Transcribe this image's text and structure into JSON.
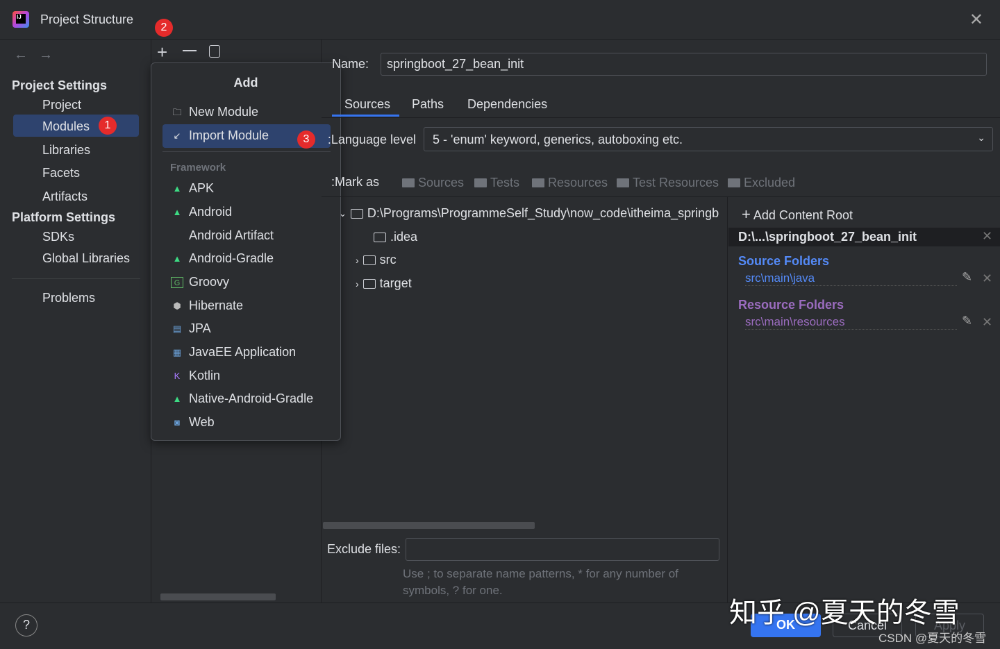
{
  "window": {
    "title": "Project Structure"
  },
  "badges": [
    "1",
    "2",
    "3"
  ],
  "sidebar": {
    "project_settings": "Project Settings",
    "project_items": [
      "Project",
      "Modules",
      "Libraries",
      "Facets",
      "Artifacts"
    ],
    "platform_settings": "Platform Settings",
    "platform_items": [
      "SDKs",
      "Global Libraries"
    ],
    "problems": "Problems"
  },
  "popup": {
    "title": "Add",
    "new_module": "New Module",
    "import_module": "Import Module",
    "framework_header": "Framework",
    "frameworks": [
      "APK",
      "Android",
      "Android Artifact",
      "Android-Gradle",
      "Groovy",
      "Hibernate",
      "JPA",
      "JavaEE Application",
      "Kotlin",
      "Native-Android-Gradle",
      "Web"
    ]
  },
  "module": {
    "name_label": "Name:",
    "name_value": "springboot_27_bean_init",
    "tabs": [
      "Sources",
      "Paths",
      "Dependencies"
    ],
    "language_label": "Language level:",
    "language_value": "5 - 'enum' keyword, generics, autoboxing etc.",
    "mark_as_label": "Mark as:",
    "mark_as": [
      "Sources",
      "Tests",
      "Resources",
      "Test Resources",
      "Excluded"
    ],
    "tree": {
      "root": "D:\\Programs\\ProgrammeSelf_Study\\now_code\\itheima_springb",
      "children": [
        ".idea",
        "src",
        "target"
      ]
    },
    "exclude_label": "Exclude files:",
    "exclude_value": "",
    "exclude_hint": "Use ; to separate name patterns, * for any number of symbols, ? for one."
  },
  "content_root": {
    "add": "Add Content Root",
    "path": "D:\\...\\springboot_27_bean_init",
    "source_header": "Source Folders",
    "source_path": "src\\main\\java",
    "resource_header": "Resource Folders",
    "resource_path": "src\\main\\resources"
  },
  "footer": {
    "ok": "OK",
    "cancel": "Cancel",
    "apply": "Apply",
    "help": "?"
  },
  "watermark": {
    "zhihu": "知乎 @夏天的冬雪",
    "csdn": "CSDN @夏天的冬雪"
  },
  "colors": {
    "accent": "#3574f0",
    "selection": "#2e436e",
    "source": "#548af7",
    "resource": "#9b6cbf",
    "badge": "#e52b2b"
  }
}
